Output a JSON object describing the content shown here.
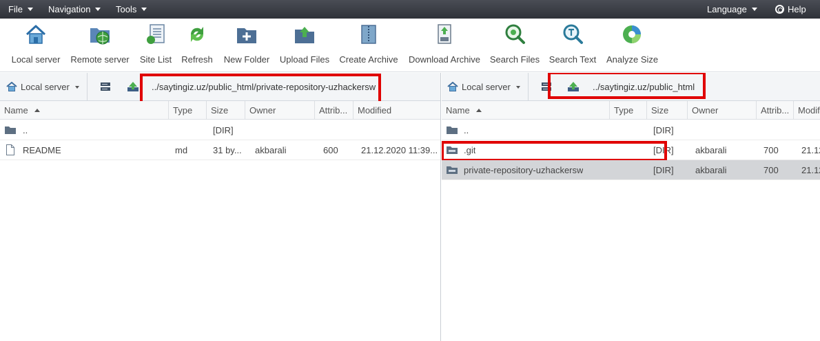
{
  "menubar": {
    "file": "File",
    "navigation": "Navigation",
    "tools": "Tools",
    "language": "Language",
    "help": "Help"
  },
  "toolbar": {
    "local_server": "Local server",
    "remote_server": "Remote server",
    "site_list": "Site List",
    "refresh": "Refresh",
    "new_folder": "New Folder",
    "upload_files": "Upload Files",
    "create_archive": "Create Archive",
    "download_archive": "Download Archive",
    "search_files": "Search Files",
    "search_text": "Search Text",
    "analyze_size": "Analyze Size"
  },
  "left": {
    "server": "Local server",
    "path": "../saytingiz.uz/public_html/private-repository-uzhackersw",
    "columns": {
      "name": "Name",
      "type": "Type",
      "size": "Size",
      "owner": "Owner",
      "attrib": "Attrib...",
      "modified": "Modified"
    },
    "rows": [
      {
        "name": "..",
        "type": "",
        "size": "[DIR]",
        "owner": "",
        "attrib": "",
        "modified": ""
      },
      {
        "name": "README",
        "type": "md",
        "size": "31 by...",
        "owner": "akbarali",
        "attrib": "600",
        "modified": "21.12.2020 11:39..."
      }
    ]
  },
  "right": {
    "server": "Local server",
    "path": "../saytingiz.uz/public_html",
    "columns": {
      "name": "Name",
      "type": "Type",
      "size": "Size",
      "owner": "Owner",
      "attrib": "Attrib...",
      "modified": "Modifi"
    },
    "rows": [
      {
        "name": "..",
        "type": "",
        "size": "[DIR]",
        "owner": "",
        "attrib": "",
        "modified": ""
      },
      {
        "name": ".git",
        "type": "",
        "size": "[DIR]",
        "owner": "akbarali",
        "attrib": "700",
        "modified": "21.12"
      },
      {
        "name": "private-repository-uzhackersw",
        "type": "",
        "size": "[DIR]",
        "owner": "akbarali",
        "attrib": "700",
        "modified": "21.12"
      }
    ]
  },
  "colors": {
    "highlight": "#e00000",
    "selected_row": "#d3d5d8",
    "menubar": "#3a3d44"
  }
}
